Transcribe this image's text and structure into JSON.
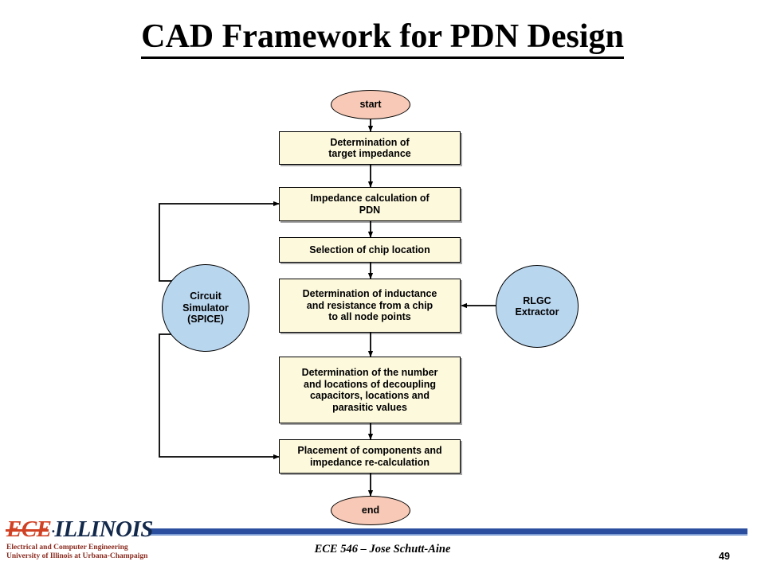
{
  "slide": {
    "title": "CAD Framework for PDN Design",
    "number": "49",
    "footer": "ECE 546 – Jose Schutt-Aine"
  },
  "logo": {
    "ece": "ECE",
    "separator": "·",
    "illinois": "ILLINOIS",
    "dept_line1": "Electrical and Computer Engineering",
    "dept_line2": "University of Illinois at Urbana-Champaign"
  },
  "flowchart": {
    "nodes": [
      {
        "id": "start",
        "shape": "ellipse",
        "label": "start",
        "color": "#f7c9b6"
      },
      {
        "id": "target-impedance",
        "shape": "rect",
        "label": "Determination of\ntarget impedance",
        "color": "#fdf9dd"
      },
      {
        "id": "impedance-calculation",
        "shape": "rect",
        "label": "Impedance calculation of\nPDN",
        "color": "#fdf9dd"
      },
      {
        "id": "chip-location",
        "shape": "rect",
        "label": "Selection of chip location",
        "color": "#fdf9dd"
      },
      {
        "id": "inductance-resistance",
        "shape": "rect",
        "label": "Determination of inductance\nand resistance from a chip\nto all node points",
        "color": "#fdf9dd"
      },
      {
        "id": "decoupling-capacitors",
        "shape": "rect",
        "label": "Determination of the number\nand locations of decoupling\ncapacitors, locations and\nparasitic values",
        "color": "#fdf9dd"
      },
      {
        "id": "placement-components",
        "shape": "rect",
        "label": "Placement of components and\nimpedance re-calculation",
        "color": "#fdf9dd"
      },
      {
        "id": "end",
        "shape": "ellipse",
        "label": "end",
        "color": "#f7c9b6"
      },
      {
        "id": "circuit-simulator",
        "shape": "circle",
        "label": "Circuit\nSimulator\n(SPICE)",
        "color": "#b9d6ef"
      },
      {
        "id": "rlgc-extractor",
        "shape": "circle",
        "label": "RLGC\nExtractor",
        "color": "#b9d6ef"
      }
    ],
    "edges": [
      {
        "from": "start",
        "to": "target-impedance"
      },
      {
        "from": "target-impedance",
        "to": "impedance-calculation"
      },
      {
        "from": "impedance-calculation",
        "to": "chip-location"
      },
      {
        "from": "chip-location",
        "to": "inductance-resistance"
      },
      {
        "from": "inductance-resistance",
        "to": "decoupling-capacitors"
      },
      {
        "from": "decoupling-capacitors",
        "to": "placement-components"
      },
      {
        "from": "placement-components",
        "to": "end"
      },
      {
        "from": "rlgc-extractor",
        "to": "inductance-resistance"
      },
      {
        "from": "circuit-simulator",
        "to": "impedance-calculation"
      },
      {
        "from": "circuit-simulator",
        "to": "placement-components"
      }
    ]
  }
}
